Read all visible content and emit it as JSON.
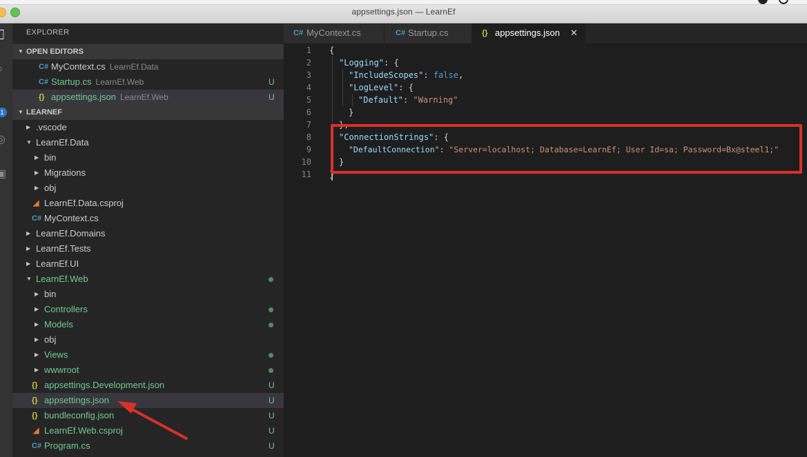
{
  "window": {
    "title": "appsettings.json — LearnEf"
  },
  "activity_bar": {
    "scm_badge": "1"
  },
  "explorer": {
    "title": "EXPLORER",
    "open_editors_header": "OPEN EDITORS",
    "open_editors": [
      {
        "name": "MyContext.cs",
        "project": "LearnEf.Data",
        "icon": "csharp-icon",
        "status": ""
      },
      {
        "name": "Startup.cs",
        "project": "LearnEf.Web",
        "icon": "csharp-icon",
        "status": "U"
      },
      {
        "name": "appsettings.json",
        "project": "LearnEf.Web",
        "icon": "json-icon",
        "status": "U"
      }
    ],
    "workspace_header": "LEARNEF",
    "tree": [
      {
        "name": ".vscode",
        "type": "folder",
        "status": ""
      },
      {
        "name": "LearnEf.Data",
        "type": "folder-open",
        "status": ""
      },
      {
        "name": "bin",
        "type": "folder",
        "status": ""
      },
      {
        "name": "Migrations",
        "type": "folder",
        "status": ""
      },
      {
        "name": "obj",
        "type": "folder",
        "status": ""
      },
      {
        "name": "LearnEf.Data.csproj",
        "type": "rss-icon",
        "status": ""
      },
      {
        "name": "MyContext.cs",
        "type": "csharp-icon",
        "status": ""
      },
      {
        "name": "LearnEf.Domains",
        "type": "folder",
        "status": ""
      },
      {
        "name": "LearnEf.Tests",
        "type": "folder",
        "status": ""
      },
      {
        "name": "LearnEf.UI",
        "type": "folder",
        "status": ""
      },
      {
        "name": "LearnEf.Web",
        "type": "folder-open",
        "status": "dot"
      },
      {
        "name": "bin",
        "type": "folder",
        "status": ""
      },
      {
        "name": "Controllers",
        "type": "folder",
        "status": "dot"
      },
      {
        "name": "Models",
        "type": "folder",
        "status": "dot"
      },
      {
        "name": "obj",
        "type": "folder",
        "status": ""
      },
      {
        "name": "Views",
        "type": "folder",
        "status": "dot"
      },
      {
        "name": "wwwroot",
        "type": "folder",
        "status": "dot"
      },
      {
        "name": "appsettings.Development.json",
        "type": "json-icon",
        "status": "U"
      },
      {
        "name": "appsettings.json",
        "type": "json-icon",
        "status": "U"
      },
      {
        "name": "bundleconfig.json",
        "type": "json-icon",
        "status": "U"
      },
      {
        "name": "LearnEf.Web.csproj",
        "type": "rss-icon",
        "status": "U"
      },
      {
        "name": "Program.cs",
        "type": "csharp-icon",
        "status": "U"
      }
    ]
  },
  "tabs": [
    {
      "label": "MyContext.cs",
      "icon": "csharp-icon"
    },
    {
      "label": "Startup.cs",
      "icon": "csharp-icon"
    },
    {
      "label": "appsettings.json",
      "icon": "json-icon"
    }
  ],
  "editor": {
    "line_numbers": [
      "1",
      "2",
      "3",
      "4",
      "5",
      "6",
      "7",
      "8",
      "9",
      "10",
      "11"
    ],
    "code": {
      "l1": "{",
      "l2_key": "\"Logging\"",
      "l2_rest": ": {",
      "l3_key": "\"IncludeScopes\"",
      "l3_sep": ": ",
      "l3_val": "false",
      "l3_end": ",",
      "l4_key": "\"LogLevel\"",
      "l4_rest": ": {",
      "l5_key": "\"Default\"",
      "l5_sep": ": ",
      "l5_val": "\"Warning\"",
      "l6": "}",
      "l7": "},",
      "l8_key": "\"ConnectionStrings\"",
      "l8_rest": ": {",
      "l9_key": "\"DefaultConnection\"",
      "l9_sep": ": ",
      "l9_val": "\"Server=localhost; Database=LearnEf; User Id=sa; Password=Bx@steel1;\"",
      "l10": "}",
      "l11": "}"
    }
  },
  "colors": {
    "highlight_box": "#d9302a",
    "arrow": "#d9302a"
  }
}
